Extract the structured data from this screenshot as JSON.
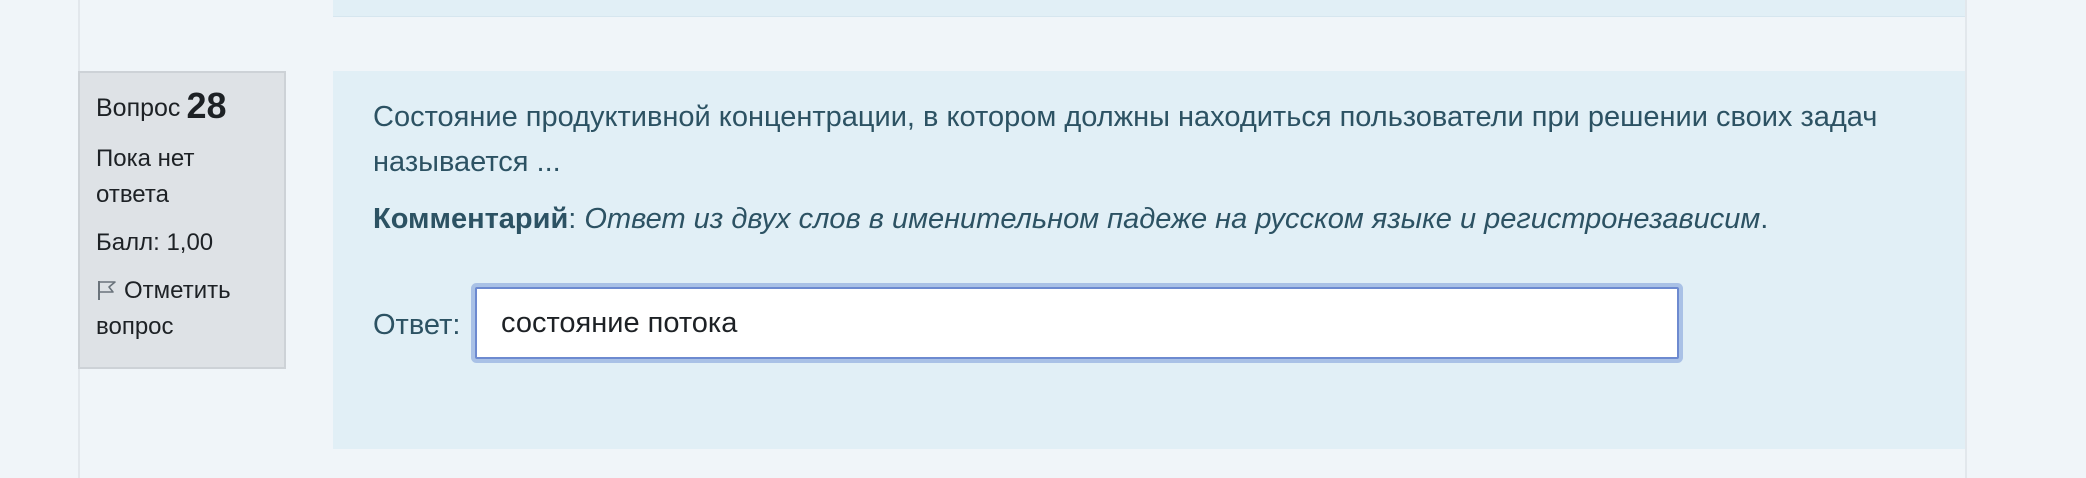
{
  "question_info": {
    "label": "Вопрос",
    "number": "28",
    "state_line1": "Пока нет",
    "state_line2": "ответа",
    "grade": "Балл: 1,00",
    "flag_line1": "Отметить",
    "flag_line2": "вопрос",
    "flag_icon": "flag-icon"
  },
  "question": {
    "text": "Состояние продуктивной концентрации, в котором должны находиться пользователи при решении своих задач называется ...",
    "comment_label": "Комментарий",
    "comment_separator": ":",
    "comment_text": "Ответ из двух слов в именительном падеже на русском языке и регистронезависим",
    "comment_end": ".",
    "answer_label": "Ответ:",
    "answer_value": "состояние потока"
  },
  "colors": {
    "page_background": "#f0f5f9",
    "content_background": "#e1eff6",
    "info_background": "#dee2e6",
    "text": "#2c5263",
    "input_focus": "#6d8ad0"
  }
}
